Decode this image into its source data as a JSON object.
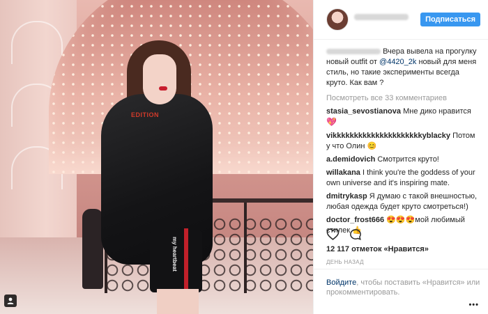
{
  "post": {
    "follow_label": "Подписаться",
    "caption_text": "Вчера вывела на прогулку новый outfit от ",
    "caption_mention": "@4420_2k",
    "caption_rest": " новый для меня стиль, но такие эксперименты всегда круто. Как вам ?",
    "view_all": "Посмотреть все 33 комментариев"
  },
  "photo": {
    "jacket_text": "EDITION",
    "shorts_text": "my heartbeat"
  },
  "comments": [
    {
      "user": "stasia_sevostianova",
      "text": "Мне дико нравится",
      "emoji": "💖"
    },
    {
      "user": "vikkkkkkkkkkkkkkkkkkkkkyblacky",
      "text": "Потом у что Олин",
      "emoji": "😊"
    },
    {
      "user": "a.demidovich",
      "text": "Смотрится круто!",
      "emoji": ""
    },
    {
      "user": "willakana",
      "text": "I think you're the goddess of your own universe and it's inspiring mate.",
      "emoji": ""
    },
    {
      "user": "dmitrykasp",
      "text": "Я думаю с такой внешностью, любая одежда будет круто смотреться!)",
      "emoji": ""
    },
    {
      "user": "doctor_frost666",
      "text": "мой любимый стилек",
      "emoji": "😍😍😍",
      "emoji_end": "👍"
    }
  ],
  "likes": "12 117 отметок «Нравится»",
  "time": "ДЕНЬ НАЗАД",
  "login": {
    "link": "Войдите",
    "text": ", чтобы поставить «Нравится» или прокомментировать."
  },
  "more_label": "•••",
  "icons": {
    "like": "heart-outline-icon",
    "comment": "comment-bubble-icon",
    "user_badge": "user-icon"
  },
  "colors": {
    "follow_button": "#3897f0",
    "link": "#003569",
    "muted": "#999999"
  }
}
